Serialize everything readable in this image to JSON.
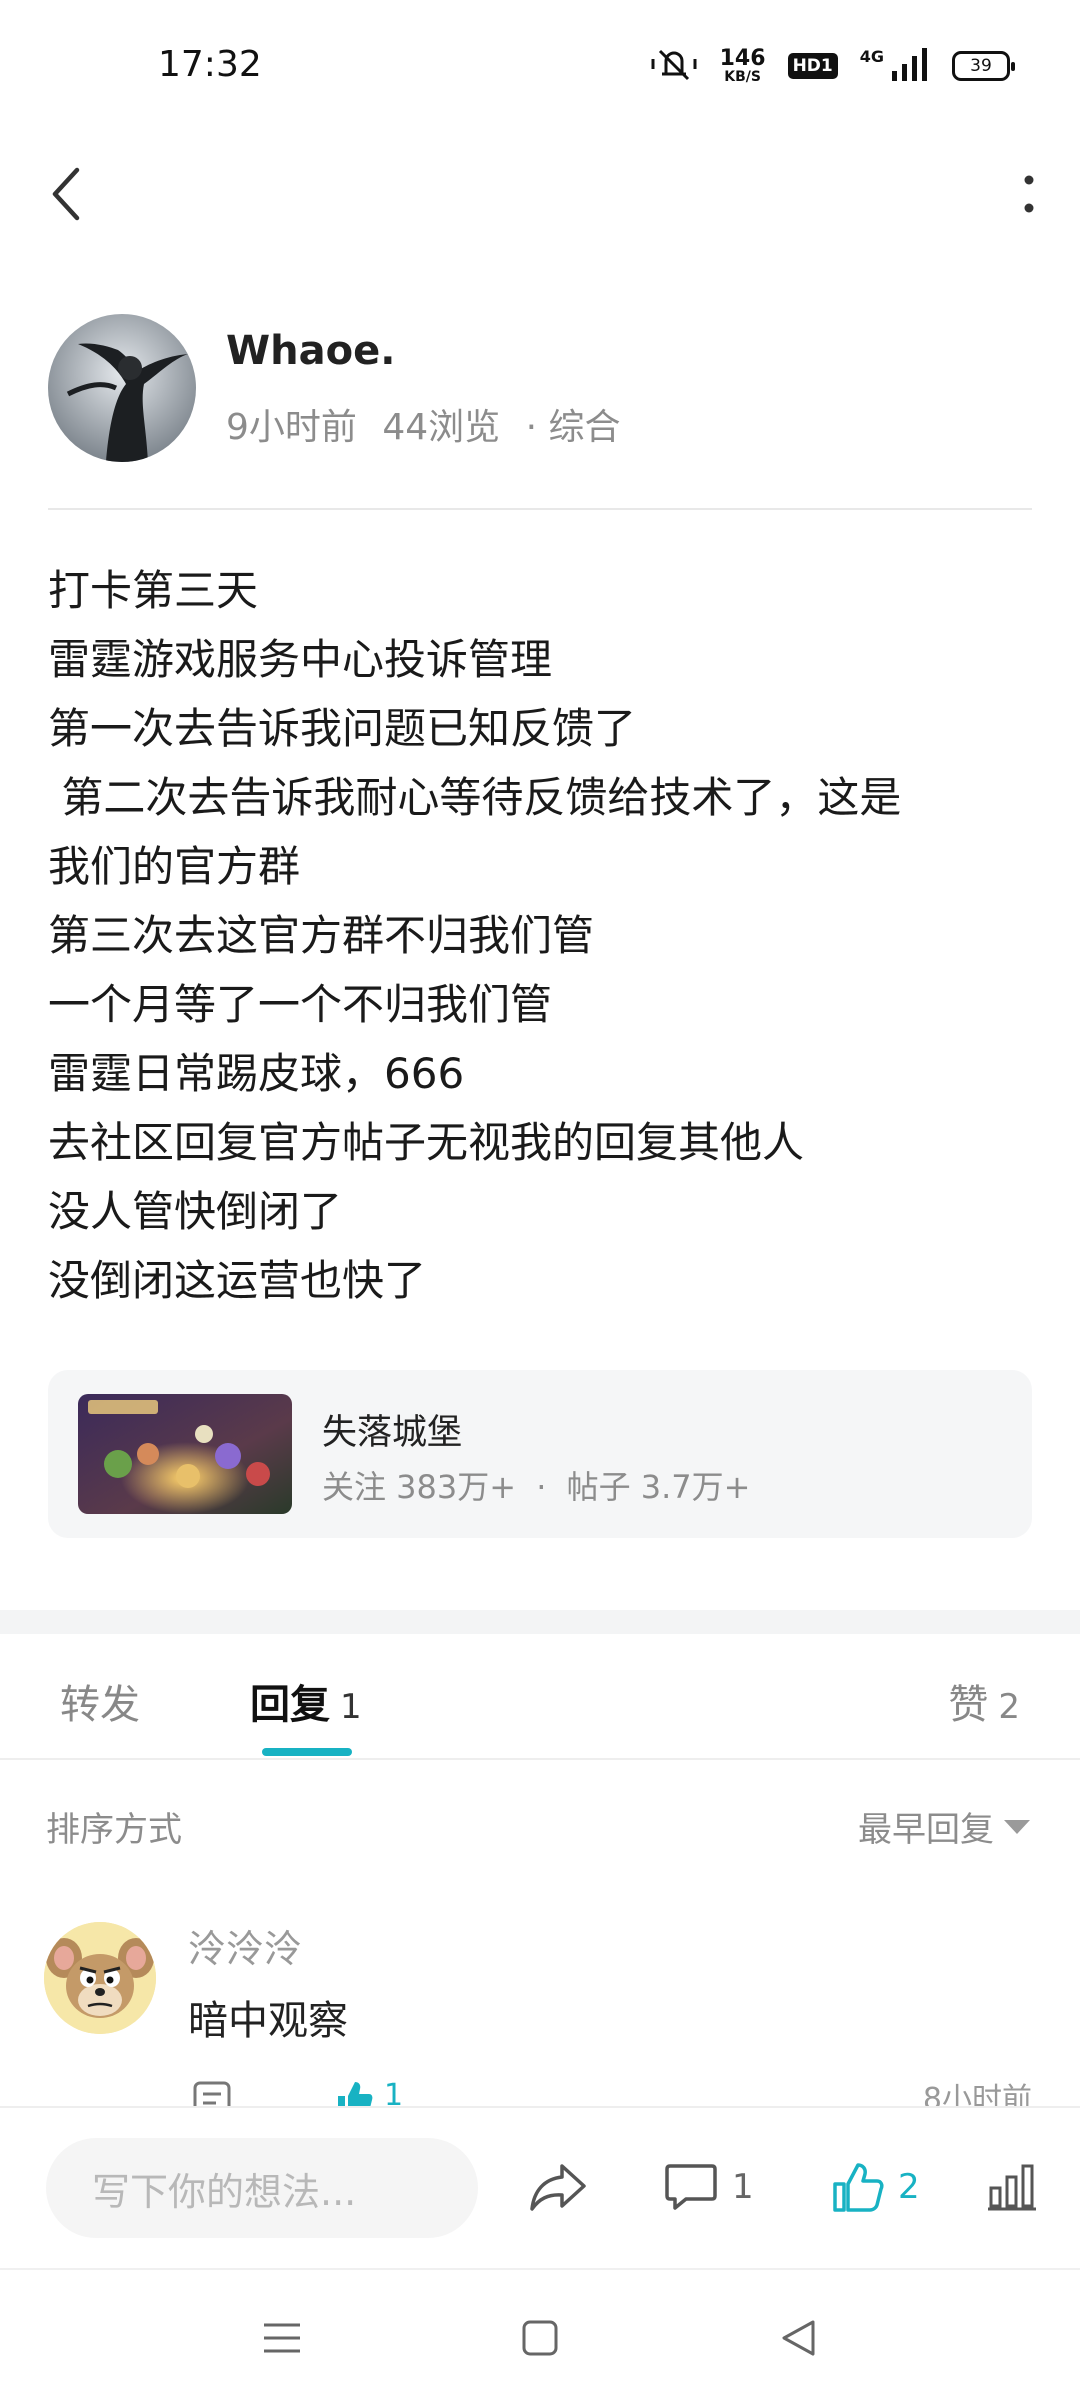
{
  "status_bar": {
    "time": "17:32",
    "net_speed": "146",
    "net_unit": "KB/S",
    "hd": "HD1",
    "network": "4G",
    "battery": "39",
    "icons": [
      "mute-vibrate-icon",
      "signal-icon",
      "battery-icon"
    ]
  },
  "nav": {
    "back_icon": "chevron-left-icon",
    "more_icon": "more-vertical-icon"
  },
  "author": {
    "name": "Whaoe.",
    "time_ago": "9小时前",
    "views": "44浏览",
    "category": "· 综合"
  },
  "post": {
    "lines": [
      "打卡第三天",
      "雷霆游戏服务中心投诉管理",
      "第一次去告诉我问题已知反馈了",
      " 第二次去告诉我耐心等待反馈给技术了，这是",
      "我们的官方群",
      "第三次去这官方群不归我们管",
      "一个月等了一个不归我们管",
      "雷霆日常踢皮球，666",
      "去社区回复官方帖子无视我的回复其他人",
      "没人管快倒闭了",
      "没倒闭这运营也快了"
    ]
  },
  "game_card": {
    "name": "失落城堡",
    "followers": "关注 383万+",
    "separator": "·",
    "posts": "帖子 3.7万+"
  },
  "tabs": {
    "forward": "转发",
    "reply": "回复",
    "reply_count": "1",
    "likes": "赞",
    "likes_count": "2",
    "accent": "#18b2c3"
  },
  "sort": {
    "label": "排序方式",
    "selected": "最早回复"
  },
  "comment": {
    "user": "泠泠泠",
    "text": "暗中观察",
    "likes": "1",
    "time": "8小时前"
  },
  "bottom_bar": {
    "placeholder": "写下你的想法...",
    "comment_count": "1",
    "like_count": "2"
  }
}
